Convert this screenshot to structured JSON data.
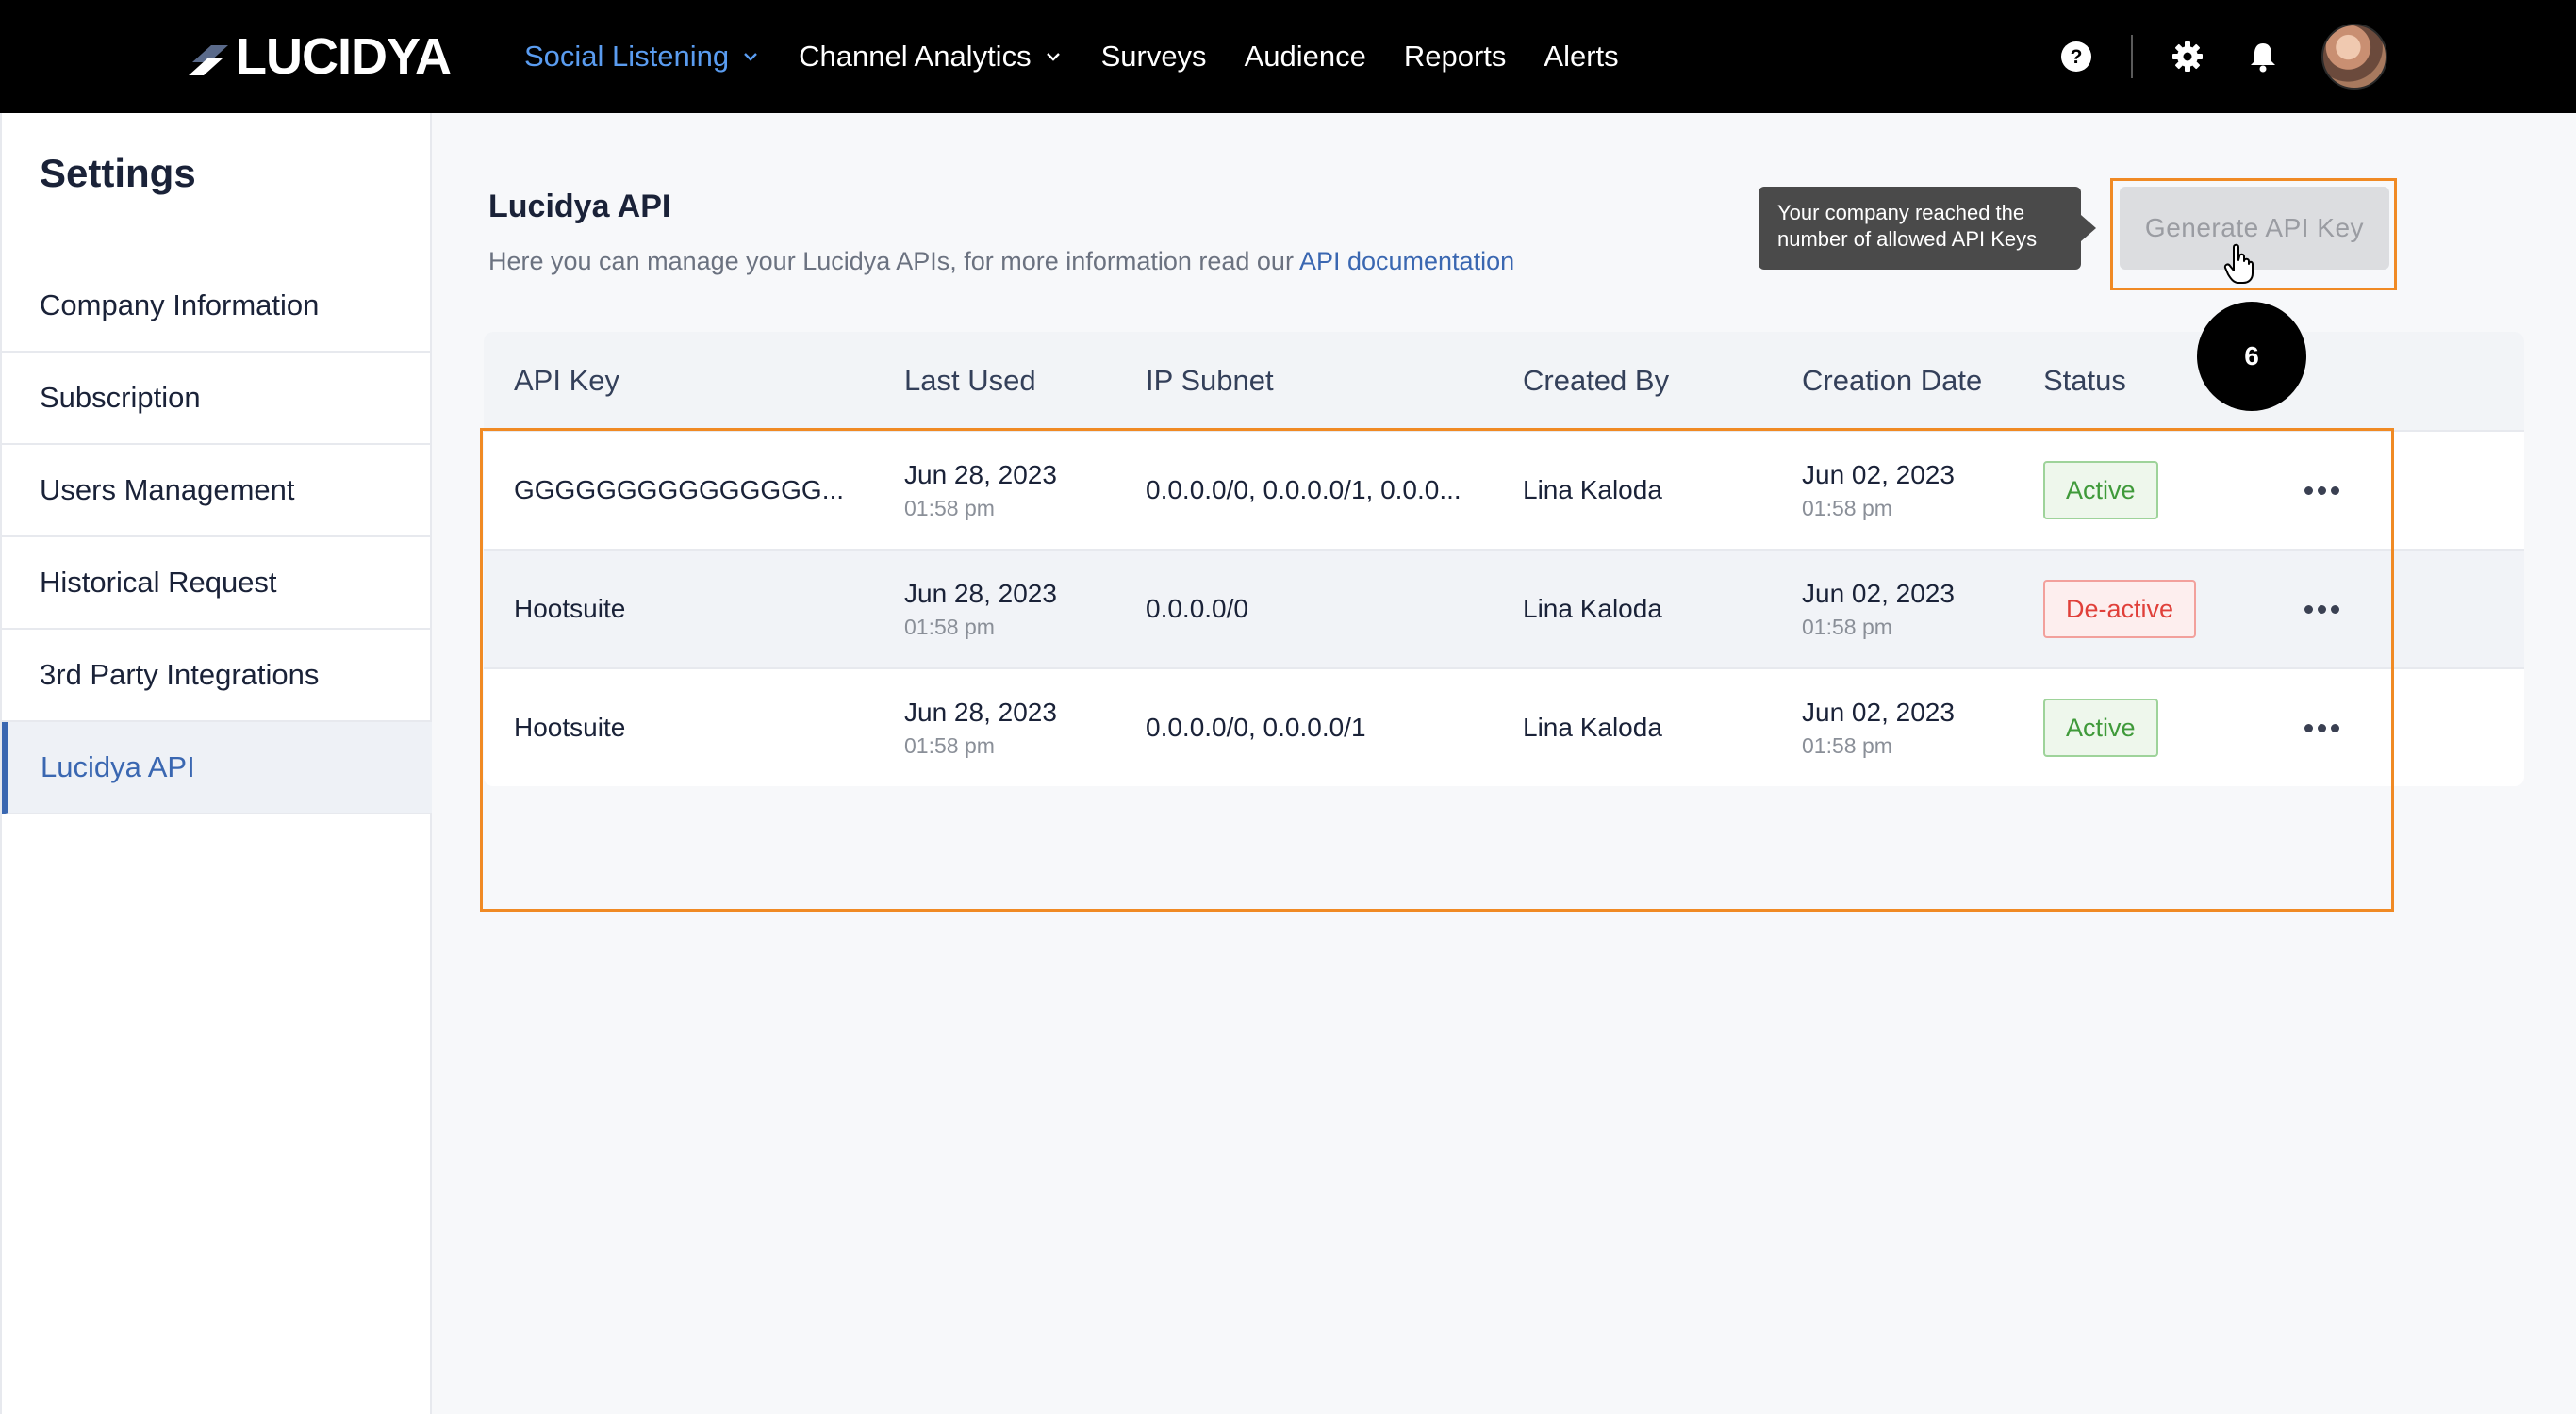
{
  "brand": {
    "name": "LUCIDYA"
  },
  "nav": {
    "items": [
      {
        "label": "Social Listening",
        "active": true,
        "dropdown": true
      },
      {
        "label": "Channel Analytics",
        "active": false,
        "dropdown": true
      },
      {
        "label": "Surveys",
        "active": false,
        "dropdown": false
      },
      {
        "label": "Audience",
        "active": false,
        "dropdown": false
      },
      {
        "label": "Reports",
        "active": false,
        "dropdown": false
      },
      {
        "label": "Alerts",
        "active": false,
        "dropdown": false
      }
    ],
    "icons": [
      "help-icon",
      "gear-icon",
      "bell-icon",
      "avatar"
    ]
  },
  "sidebar": {
    "title": "Settings",
    "items": [
      {
        "label": "Company Information",
        "active": false
      },
      {
        "label": "Subscription",
        "active": false
      },
      {
        "label": "Users Management",
        "active": false
      },
      {
        "label": "Historical Request",
        "active": false
      },
      {
        "label": "3rd Party Integrations",
        "active": false
      },
      {
        "label": "Lucidya API",
        "active": true
      }
    ]
  },
  "page": {
    "title": "Lucidya API",
    "description": "Here you can manage your Lucidya APIs, for more information read our ",
    "doc_link": "API documentation",
    "tooltip": "Your company reached the number of allowed API Keys",
    "generate_button": "Generate API Key",
    "step_badge": "6"
  },
  "table": {
    "headers": {
      "key": "API Key",
      "last_used": "Last Used",
      "ip": "IP Subnet",
      "created_by": "Created By",
      "created": "Creation Date",
      "status": "Status"
    },
    "rows": [
      {
        "key": "GGGGGGGGGGGGGGG...",
        "last_date": "Jun 28, 2023",
        "last_time": "01:58 pm",
        "ip": "0.0.0.0/0, 0.0.0.0/1, 0.0.0...",
        "created_by": "Lina Kaloda",
        "created_date": "Jun 02, 2023",
        "created_time": "01:58 pm",
        "status": "Active"
      },
      {
        "key": "Hootsuite",
        "last_date": "Jun 28, 2023",
        "last_time": "01:58 pm",
        "ip": "0.0.0.0/0",
        "created_by": "Lina Kaloda",
        "created_date": "Jun 02, 2023",
        "created_time": "01:58 pm",
        "status": "De-active"
      },
      {
        "key": "Hootsuite",
        "last_date": "Jun 28, 2023",
        "last_time": "01:58 pm",
        "ip": "0.0.0.0/0, 0.0.0.0/1",
        "created_by": "Lina Kaloda",
        "created_date": "Jun 02, 2023",
        "created_time": "01:58 pm",
        "status": "Active"
      }
    ]
  },
  "colors": {
    "accent": "#3a67b1",
    "nav_active": "#5a9cf0",
    "highlight": "#f08a24",
    "status_active": "#3f9a3a",
    "status_inactive": "#e0403a"
  }
}
